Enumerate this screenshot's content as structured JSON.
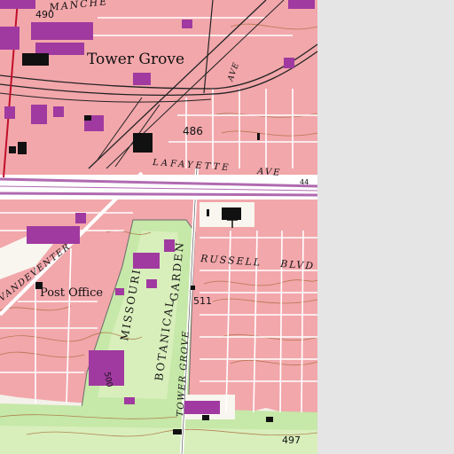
{
  "map": {
    "colors": {
      "urban": "#f2a7ab",
      "urban_dark": "#e48f95",
      "building": "#a03aa0",
      "park": "#c6e8a8",
      "park_light": "#d8efbc",
      "no_data": "#e5e5e5",
      "contour": "#a86a3a",
      "road_major": "#b06ab0",
      "railroad": "#222222",
      "boundary": "#c0102a",
      "water_tower_icon": "#111111"
    },
    "labels": {
      "place_name": "Tower Grove",
      "street_lafayette": "LAFAYETTE",
      "street_ave": "AVE",
      "street_russell": "RUSSELL",
      "street_blvd": "BLVD",
      "street_manchester_top": "MANCHE",
      "street_vandeventer": "VANDEVENTER",
      "street_tower_grove": "TOWER GROVE",
      "street_grand_ave": "AVE",
      "park_name_1": "MISSOURI",
      "park_name_2": "BOTANICAL",
      "park_name_3": "GARDEN",
      "building_post_office": "Post Office",
      "elev_490": "490",
      "elev_486": "486",
      "elev_511": "511",
      "elev_497": "497",
      "elev_500": "500",
      "hwy_44": "44"
    },
    "icons": {
      "church": "church-cross-icon",
      "school": "school-flag-icon"
    }
  }
}
